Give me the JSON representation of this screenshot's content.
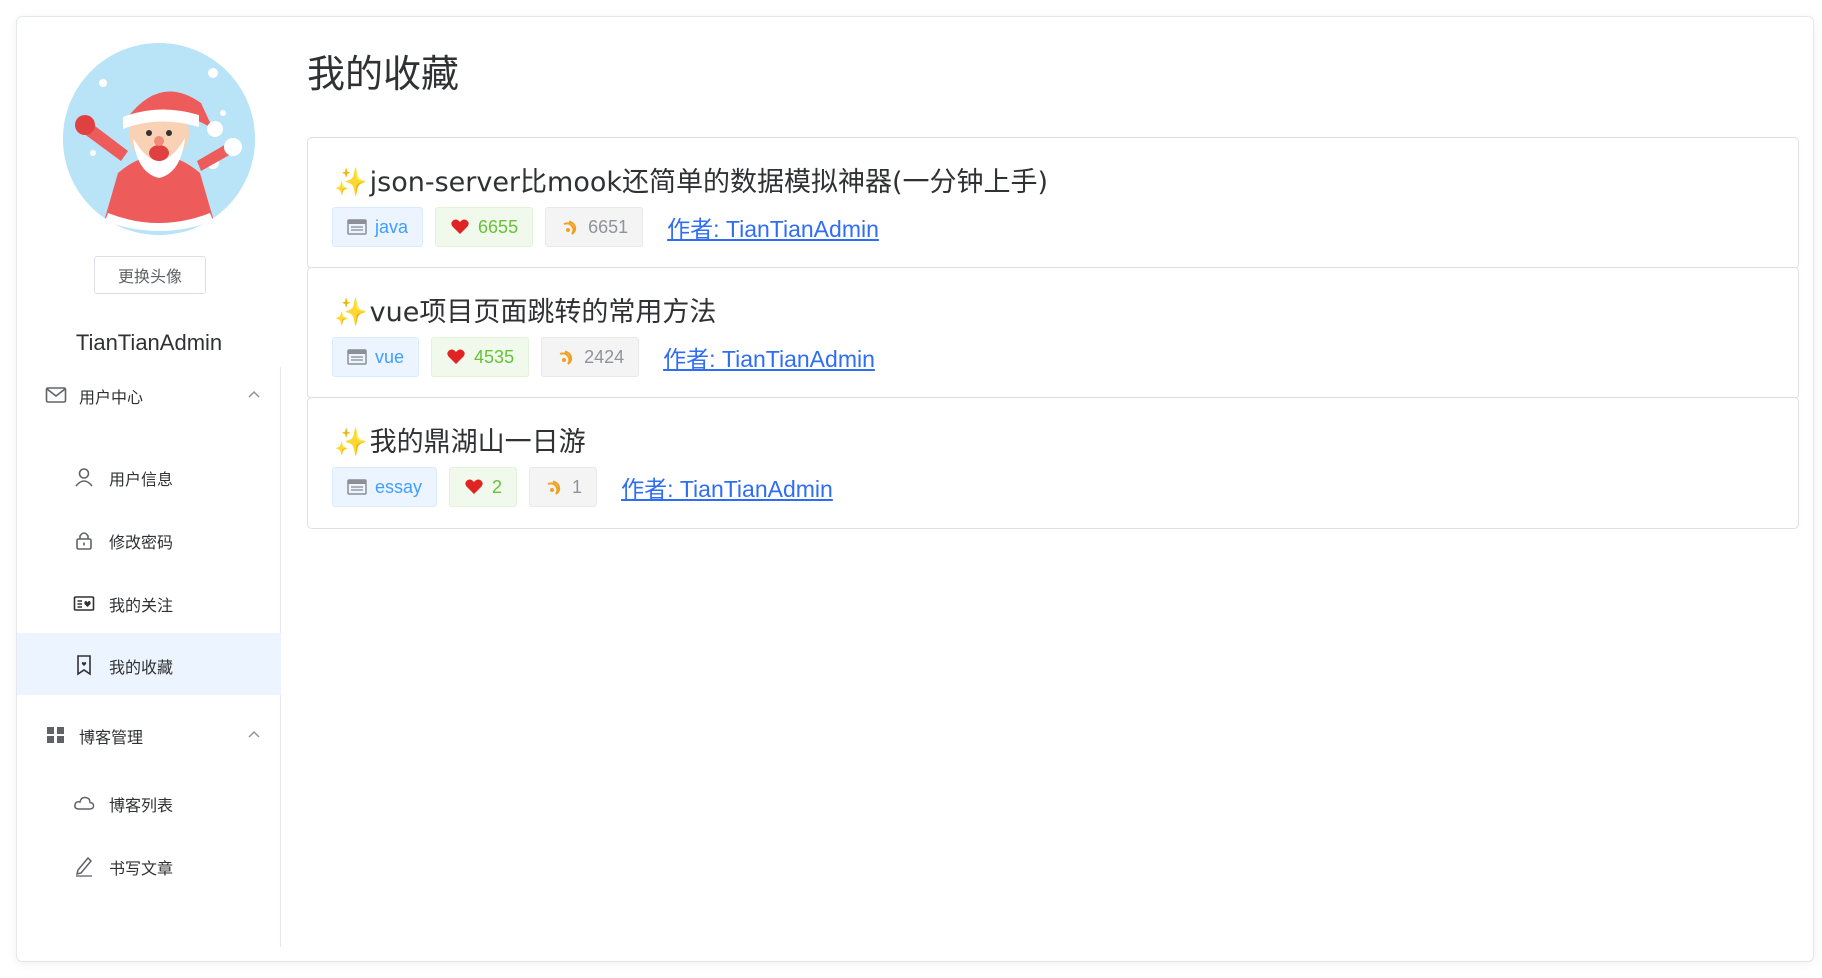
{
  "sidebar": {
    "change_avatar_label": "更换头像",
    "username": "TianTianAdmin",
    "groups": [
      {
        "label": "用户中心",
        "icon": "mail-icon",
        "items": [
          {
            "label": "用户信息",
            "icon": "user-icon"
          },
          {
            "label": "修改密码",
            "icon": "lock-icon"
          },
          {
            "label": "我的关注",
            "icon": "follow-card-icon"
          },
          {
            "label": "我的收藏",
            "icon": "bookmark-icon",
            "active": true
          }
        ]
      },
      {
        "label": "博客管理",
        "icon": "grid-icon",
        "items": [
          {
            "label": "博客列表",
            "icon": "cloud-icon"
          },
          {
            "label": "书写文章",
            "icon": "pen-icon"
          }
        ]
      }
    ]
  },
  "main": {
    "page_title": "我的收藏",
    "favorites": [
      {
        "spark": "✨",
        "title": "json-server比mook还简单的数据模拟神器(一分钟上手)",
        "category": "java",
        "likes": "6655",
        "views": "6651",
        "author": "作者: TianTianAdmin"
      },
      {
        "spark": "✨",
        "title": "vue项目页面跳转的常用方法",
        "category": "vue",
        "likes": "4535",
        "views": "2424",
        "author": "作者: TianTianAdmin"
      },
      {
        "spark": "✨",
        "title": "我的鼎湖山一日游",
        "category": "essay",
        "likes": "2",
        "views": "1",
        "author": "作者: TianTianAdmin"
      }
    ]
  },
  "colors": {
    "active_bg": "#ecf5ff",
    "link": "#2f6df5",
    "like_heart": "#e02424",
    "likes_text": "#67c23a",
    "category_text": "#409eff",
    "views_text": "#909399"
  }
}
